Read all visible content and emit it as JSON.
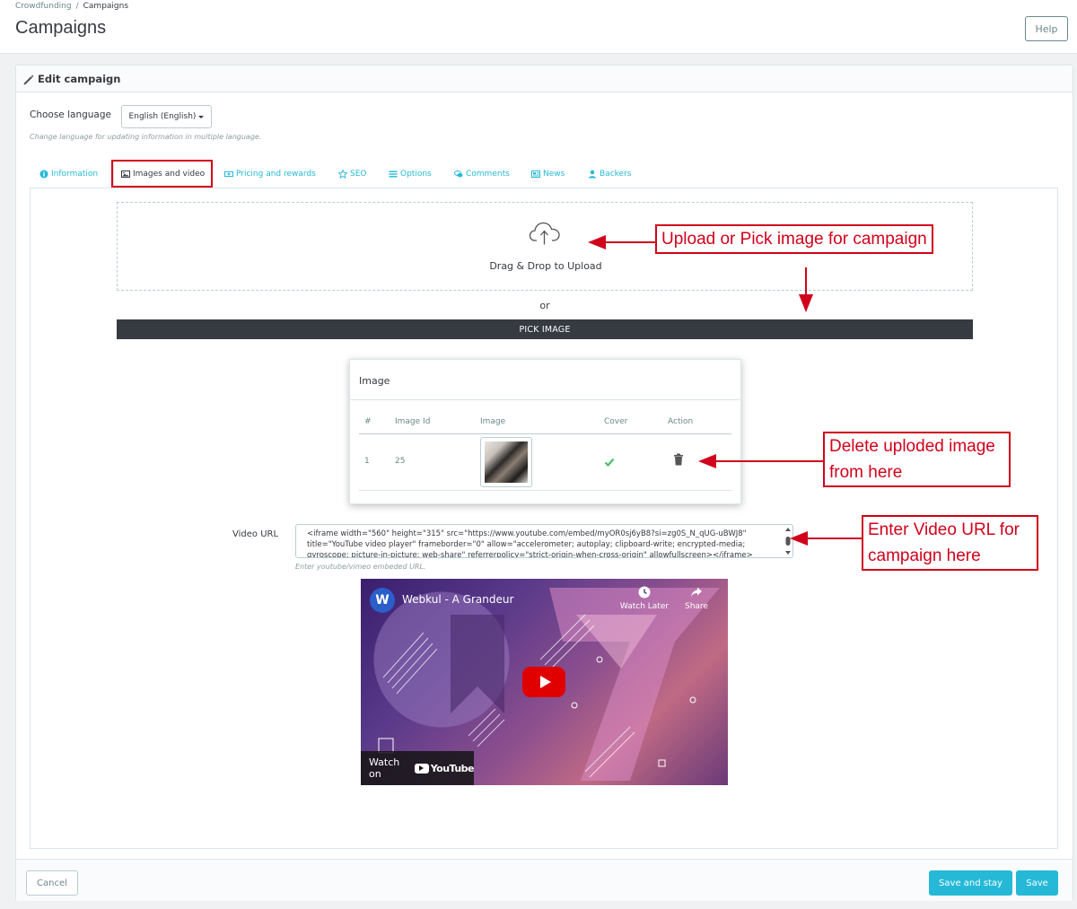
{
  "breadcrumb": {
    "parent": "Crowdfunding",
    "separator": "/",
    "current": "Campaigns"
  },
  "header": {
    "title": "Campaigns",
    "help_label": "Help"
  },
  "panel": {
    "title": "Edit campaign",
    "language": {
      "label": "Choose language",
      "selected": "English (English)",
      "help": "Change language for updating information in multiple language."
    },
    "tabs": [
      {
        "label": "Information",
        "icon": "info-circle-icon"
      },
      {
        "label": "Images and video",
        "icon": "image-icon",
        "active": true
      },
      {
        "label": "Pricing and rewards",
        "icon": "money-icon"
      },
      {
        "label": "SEO",
        "icon": "star-icon"
      },
      {
        "label": "Options",
        "icon": "list-icon"
      },
      {
        "label": "Comments",
        "icon": "comments-icon"
      },
      {
        "label": "News",
        "icon": "newspaper-icon"
      },
      {
        "label": "Backers",
        "icon": "user-icon"
      }
    ],
    "upload": {
      "dropzone_text": "Drag & Drop to Upload",
      "or_text": "or",
      "pick_label": "PICK IMAGE"
    },
    "image_table": {
      "title": "Image",
      "columns": [
        "#",
        "Image Id",
        "Image",
        "Cover",
        "Action"
      ],
      "rows": [
        {
          "num": "1",
          "image_id": "25",
          "cover": true
        }
      ]
    },
    "video": {
      "label": "Video URL",
      "value": "<iframe width=\"560\" height=\"315\" src=\"https://www.youtube.com/embed/myOR0sj6yB8?si=zg0S_N_qUG-uBWJ8\" title=\"YouTube video player\" frameborder=\"0\" allow=\"accelerometer; autoplay; clipboard-write; encrypted-media; gyroscope; picture-in-picture; web-share\" referrerpolicy=\"strict-origin-when-cross-origin\" allowfullscreen></iframe>",
      "help": "Enter youtube/vimeo embeded URL."
    },
    "video_preview": {
      "channel_title": "Webkul - A Grandeur",
      "watch_later": "Watch Later",
      "share": "Share",
      "watch_on": "Watch on",
      "youtube": "YouTube"
    },
    "footer": {
      "cancel": "Cancel",
      "save_and_stay": "Save and stay",
      "save": "Save"
    }
  },
  "annotations": {
    "upload": "Upload or Pick image for campaign",
    "delete_line1": "Delete uploded image",
    "delete_line2": "from here",
    "video_line1": "Enter Video URL for",
    "video_line2": "campaign here"
  },
  "colors": {
    "accent": "#25b9d7",
    "annotation": "#d0021b",
    "dark": "#363a41",
    "success": "#4cbb6c"
  }
}
